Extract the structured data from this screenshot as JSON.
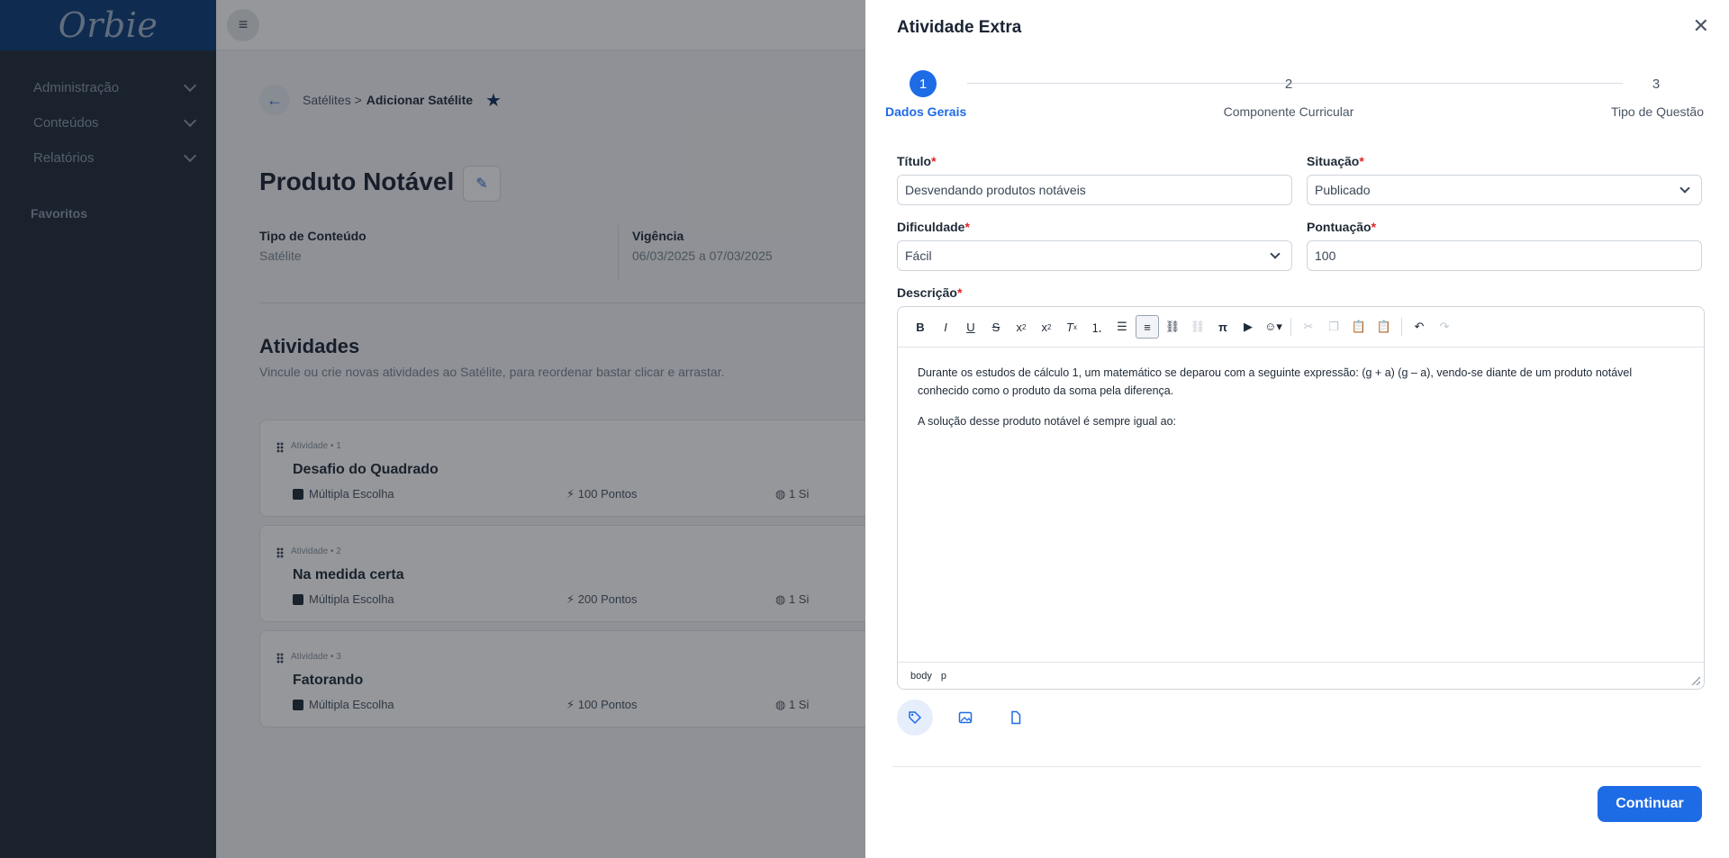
{
  "app": {
    "logo": "Orbie",
    "menu_icon": "≡"
  },
  "sidebar": {
    "items": [
      {
        "label": "Administração"
      },
      {
        "label": "Conteúdos"
      },
      {
        "label": "Relatórios"
      }
    ],
    "favorites_label": "Favoritos"
  },
  "page": {
    "breadcrumb_parent": "Satélites >",
    "breadcrumb_current": "Adicionar Satélite",
    "title": "Produto Notável",
    "content_type_label": "Tipo de Conteúdo",
    "content_type_value": "Satélite",
    "validity_label": "Vigência",
    "validity_value": "06/03/2025 a 07/03/2025",
    "activities_title": "Atividades",
    "activities_subtitle": "Vincule ou crie novas atividades ao Satélite, para reordenar bastar clicar e arrastar.",
    "activities": [
      {
        "tag": "Atividade • 1",
        "name": "Desafio do Quadrado",
        "type": "Múltipla Escolha",
        "points": "100 Pontos",
        "extra": "1 Si"
      },
      {
        "tag": "Atividade • 2",
        "name": "Na medida certa",
        "type": "Múltipla Escolha",
        "points": "200 Pontos",
        "extra": "1 Si"
      },
      {
        "tag": "Atividade • 3",
        "name": "Fatorando",
        "type": "Múltipla Escolha",
        "points": "100 Pontos",
        "extra": "1 Si"
      }
    ]
  },
  "drawer": {
    "title": "Atividade Extra",
    "steps": [
      {
        "num": "1",
        "label": "Dados Gerais"
      },
      {
        "num": "2",
        "label": "Componente Curricular"
      },
      {
        "num": "3",
        "label": "Tipo de Questão"
      }
    ],
    "title_label": "Título",
    "title_value": "Desvendando produtos notáveis",
    "status_label": "Situação",
    "status_value": "Publicado",
    "difficulty_label": "Dificuldade",
    "difficulty_value": "Fácil",
    "score_label": "Pontuação",
    "score_value": "100",
    "description_label": "Descrição",
    "required_mark": "*",
    "editor": {
      "paragraph1": "Durante os estudos de cálculo 1, um matemático se deparou com a seguinte expressão: (g + a) (g – a), vendo-se diante de um produto notável conhecido como o produto da soma pela diferença.",
      "paragraph2": "A solução desse produto notável é sempre igual ao:",
      "status_body": "body",
      "status_p": "p"
    },
    "continue_label": "Continuar",
    "accent_color": "#1e6be6"
  }
}
